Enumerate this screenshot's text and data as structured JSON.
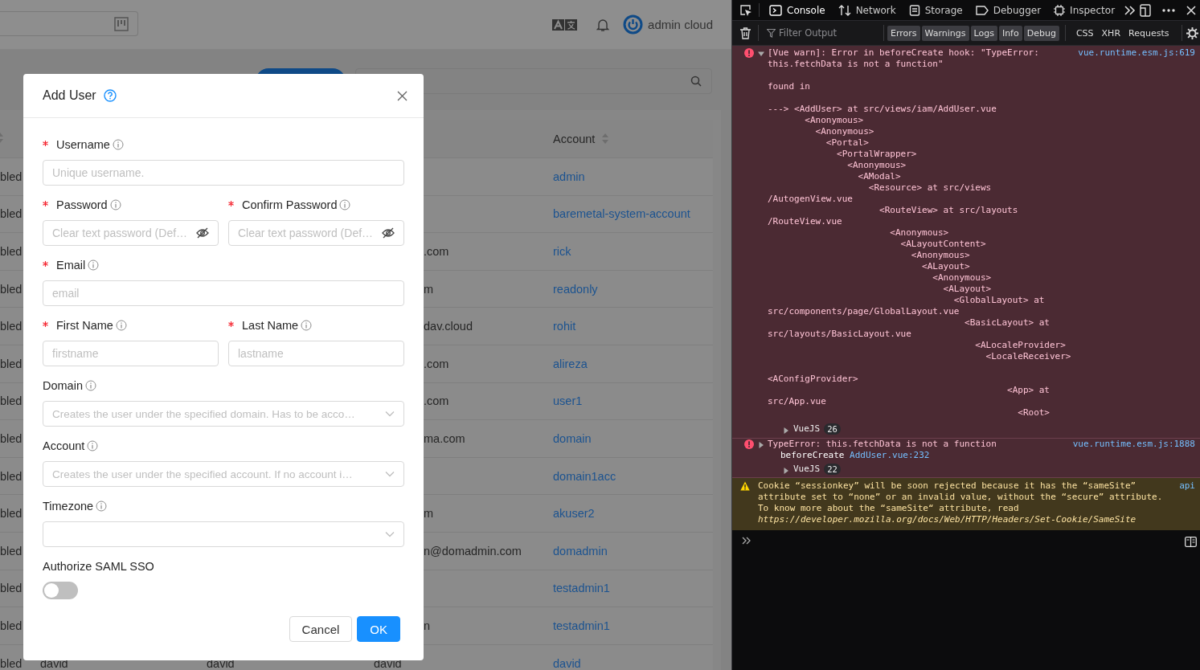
{
  "app": {
    "header": {
      "user": "admin cloud"
    },
    "table": {
      "columns": [
        {
          "label": "Account"
        }
      ],
      "rows": [
        {
          "status": "bled",
          "account": "admin"
        },
        {
          "status": "bled",
          "account": "baremetal-system-account"
        },
        {
          "status": "bled",
          "email": ".com",
          "account": "rick"
        },
        {
          "status": "bled",
          "email": "m",
          "account": "readonly"
        },
        {
          "status": "bled",
          "email": "dav.cloud",
          "account": "rohit"
        },
        {
          "status": "bled",
          "email": ".com",
          "account": "alireza"
        },
        {
          "status": "bled",
          "email": ".com",
          "account": "user1"
        },
        {
          "status": "bled",
          "email": "ma.com",
          "account": "domain"
        },
        {
          "status": "bled",
          "account": "domain1acc"
        },
        {
          "status": "bled",
          "email": "m",
          "account": "akuser2"
        },
        {
          "status": "bled",
          "email": "n@domadmin.com",
          "account": "domadmin"
        },
        {
          "status": "bled",
          "account": "testadmin1"
        },
        {
          "status": "bled",
          "email": "n",
          "account": "testadmin1"
        },
        {
          "status": "bled",
          "column_2": "david",
          "column_3": "david",
          "email": "david",
          "account": "david"
        }
      ]
    }
  },
  "modal": {
    "title": "Add User",
    "rows": [
      {
        "fields": [
          {
            "label": "Username",
            "required": true,
            "kind": "text",
            "placeholder": "Unique username."
          }
        ]
      },
      {
        "fields": [
          {
            "label": "Password",
            "required": true,
            "kind": "password",
            "placeholder": "Clear text password (Def…"
          },
          {
            "label": "Confirm Password",
            "required": true,
            "kind": "password",
            "placeholder": "Clear text password (Def…"
          }
        ]
      },
      {
        "fields": [
          {
            "label": "Email",
            "required": true,
            "kind": "text",
            "placeholder": "email"
          }
        ]
      },
      {
        "fields": [
          {
            "label": "First Name",
            "required": true,
            "kind": "text",
            "placeholder": "firstname"
          },
          {
            "label": "Last Name",
            "required": true,
            "kind": "text",
            "placeholder": "lastname"
          }
        ]
      },
      {
        "fields": [
          {
            "label": "Domain",
            "required": false,
            "kind": "select",
            "placeholder": "Creates the user under the specified domain. Has to be acco…"
          }
        ]
      },
      {
        "fields": [
          {
            "label": "Account",
            "required": false,
            "kind": "select",
            "placeholder": "Creates the user under the specified account. If no account i…"
          }
        ]
      },
      {
        "fields": [
          {
            "label": "Timezone",
            "required": false,
            "kind": "select"
          }
        ]
      },
      {
        "fields": [
          {
            "label": "Authorize SAML SSO",
            "required": false,
            "kind": "switch",
            "on": false
          }
        ]
      }
    ],
    "buttons": [
      {
        "label": "Cancel",
        "kind": "default"
      },
      {
        "label": "OK",
        "kind": "primary"
      }
    ]
  },
  "devtools": {
    "tabs": [
      {
        "label": "Console",
        "selected": true
      },
      {
        "label": "Network",
        "selected": false
      },
      {
        "label": "Storage",
        "selected": false
      },
      {
        "label": "Debugger",
        "selected": false
      },
      {
        "label": "Inspector",
        "selected": false
      }
    ],
    "filter": {
      "placeholder": "Filter Output"
    },
    "levels": [
      {
        "label": "Errors",
        "selected": true
      },
      {
        "label": "Warnings",
        "selected": true
      },
      {
        "label": "Logs",
        "selected": true
      },
      {
        "label": "Info",
        "selected": true
      },
      {
        "label": "Debug",
        "selected": true
      }
    ],
    "types": [
      {
        "label": "CSS",
        "selected": false
      },
      {
        "label": "XHR",
        "selected": false
      },
      {
        "label": "Requests",
        "selected": false
      }
    ],
    "messages": [
      {
        "kind": "error",
        "expanded": true,
        "source": "vue.runtime.esm.js:619",
        "text": "[Vue warn]: Error in beforeCreate hook: \"TypeError:\nthis.fetchData is not a function\"\n\nfound in\n\n---> <AddUser> at src/views/iam/AddUser.vue\n       <Anonymous>\n         <Anonymous>\n           <Portal>\n             <PortalWrapper>\n               <Anonymous>\n                 <AModal>\n                   <Resource> at src/views\n/AutogenView.vue\n                     <RouteView> at src/layouts\n/RouteView.vue\n                       <Anonymous>\n                         <ALayoutContent>\n                           <Anonymous>\n                             <ALayout>\n                               <Anonymous>\n                                 <ALayout>\n                                   <GlobalLayout> at\nsrc/components/page/GlobalLayout.vue\n                                     <BasicLayout> at\nsrc/layouts/BasicLayout.vue\n                                       <ALocaleProvider>\n                                         <LocaleReceiver>\n\n<AConfigProvider>\n                                             <App> at\nsrc/App.vue\n                                               <Root>",
        "group": {
          "label": "VueJS",
          "count": "26"
        }
      },
      {
        "kind": "error",
        "expanded": false,
        "source": "vue.runtime.esm.js:1888",
        "text": "TypeError: this.fetchData is not a function",
        "frame": {
          "function": "beforeCreate",
          "location": "AddUser.vue:232"
        },
        "group": {
          "label": "VueJS",
          "count": "22"
        }
      },
      {
        "kind": "warning",
        "source": "api",
        "text": "Cookie “sessionkey” will be soon rejected because it has the “sameSite”\nattribute set to “none” or an invalid value, without the “secure” attribute.\nTo know more about the “sameSite“ attribute, read ",
        "url": "https://developer.mozilla.org/docs/Web/HTTP/Headers/Set-Cookie/SameSite"
      }
    ]
  }
}
